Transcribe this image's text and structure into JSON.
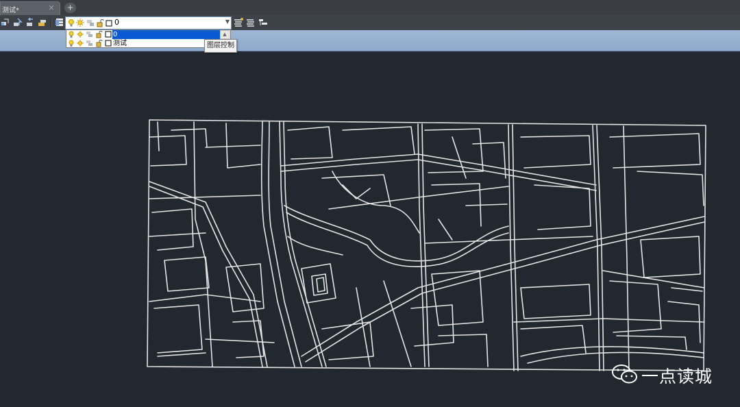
{
  "document_tab": {
    "label": "测试*",
    "close_glyph": "×",
    "new_tab_glyph": "+"
  },
  "layer_control": {
    "current_layer": "0",
    "options": [
      {
        "name": "0",
        "selected": true
      },
      {
        "name": "测试",
        "selected": false
      }
    ],
    "tooltip": "图层控制"
  },
  "colors": {
    "canvas": "#212830",
    "linework": "#e8e8e8",
    "selection": "#0a5ad2"
  },
  "watermark": {
    "text": "一点读城",
    "icon": "wechat-icon"
  }
}
